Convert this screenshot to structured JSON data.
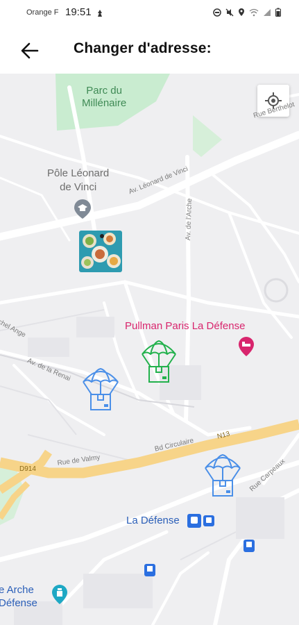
{
  "status_bar": {
    "carrier": "Orange F",
    "time": "19:51",
    "icons": [
      "notification-icon",
      "mute-icon",
      "location-icon",
      "wifi-icon",
      "signal-icon",
      "battery-icon"
    ]
  },
  "header": {
    "title": "Changer d'adresse:",
    "back_icon": "arrow-left-icon"
  },
  "map": {
    "park_label": "Parc du\nMillénaire",
    "poi_leonard": "Pôle Léonard\nde Vinci",
    "hotel_label": "Pullman Paris La Défense",
    "station_label": "La Défense",
    "arche_label": "e Arche\nDéfense",
    "streets": {
      "berthelot": "Rue Berthelot",
      "leonard": "Av. Léonard de Vinci",
      "arche": "Av. de l'Arche",
      "michel_ange": "chel Ange",
      "renaissance": "Av. de la Renai",
      "valmy": "Rue de Valmy",
      "circulaire": "Bd Circulaire",
      "n13": "N13",
      "d914": "D914",
      "carpeaux": "Rue Carpeaux"
    },
    "markers": [
      {
        "type": "parachute",
        "color": "#4a8fe8",
        "state": "available"
      },
      {
        "type": "parachute",
        "color": "#22b14c",
        "state": "selected"
      },
      {
        "type": "parachute",
        "color": "#4a8fe8",
        "state": "available"
      }
    ],
    "colors": {
      "map_bg": "#efeff1",
      "road": "#ffffff",
      "highway": "#f7d489",
      "park": "#c9ecd0",
      "hotel": "#d8256d",
      "transit": "#2b6fe0"
    }
  }
}
